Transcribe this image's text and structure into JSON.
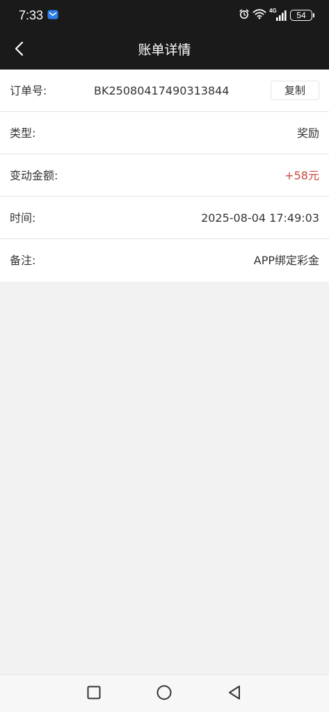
{
  "status_bar": {
    "time": "7:33",
    "network": "4G",
    "battery": "54"
  },
  "header": {
    "title": "账单详情"
  },
  "details": {
    "order_label": "订单号:",
    "order_value": "BK25080417490313844",
    "copy_label": "复制",
    "type_label": "类型:",
    "type_value": "奖励",
    "amount_label": "变动金额:",
    "amount_value": "+58元",
    "time_label": "时间:",
    "time_value": "2025-08-04 17:49:03",
    "remark_label": "备注:",
    "remark_value": "APP绑定彩金"
  },
  "colors": {
    "header_bg": "#1a1a1a",
    "amount_positive": "#c9473a",
    "page_bg": "#f2f2f2"
  },
  "icons": {
    "back": "chevron-left-icon",
    "mail": "mail-icon",
    "alarm": "alarm-icon",
    "wifi": "wifi-icon",
    "signal": "cellular-signal-icon",
    "battery": "battery-icon",
    "recent": "square-icon",
    "home": "circle-icon",
    "system_back": "triangle-back-icon"
  }
}
